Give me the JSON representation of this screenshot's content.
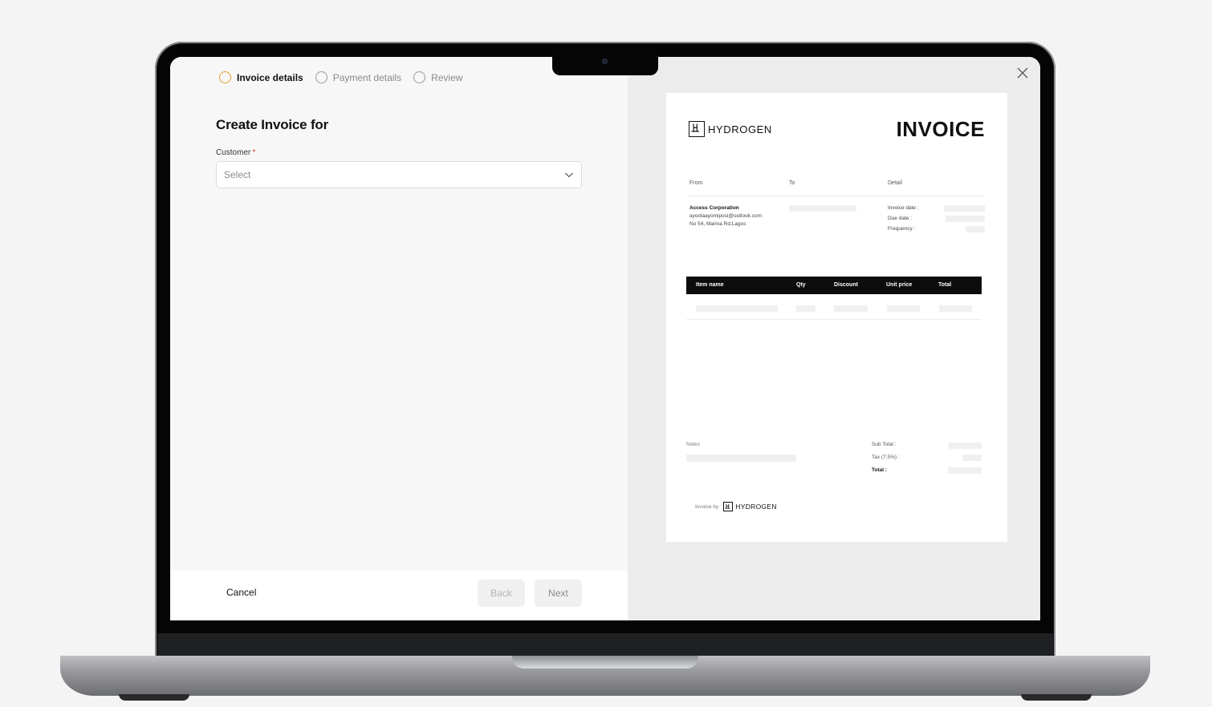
{
  "steps": [
    {
      "label": "Invoice details",
      "state": "active"
    },
    {
      "label": "Payment details",
      "state": "inactive"
    },
    {
      "label": "Review",
      "state": "inactive"
    }
  ],
  "form": {
    "heading": "Create Invoice for",
    "customer_label": "Customer",
    "required_mark": "*",
    "customer_placeholder": "Select"
  },
  "footer": {
    "cancel_label": "Cancel",
    "back_label": "Back",
    "next_label": "Next"
  },
  "preview": {
    "brand": "HYDROGEN",
    "title": "INVOICE",
    "columns": {
      "from": "From",
      "to": "To",
      "detail": "Detail"
    },
    "from": {
      "company": "Access Corporation",
      "email": "ayoolaayomiposi@outlook.com",
      "address": "No 54, Marina Rd,Lagos"
    },
    "detail_labels": {
      "invoice_date": "Invoice date :",
      "due_date": "Due date :",
      "frequency": "Frequency :"
    },
    "table_headers": [
      "Item name",
      "Qty",
      "Discount",
      "Unit price",
      "Total"
    ],
    "notes_label": "Notes",
    "totals": {
      "subtotal": "Sub Total :",
      "tax": "Tax (7.5%) :",
      "total": "Total :"
    },
    "powered_prefix": "Invoice by"
  },
  "colors": {
    "active_step_ring": "#e0a22f",
    "required": "#d23a3a",
    "table_header_bg": "#0c0c0c"
  }
}
